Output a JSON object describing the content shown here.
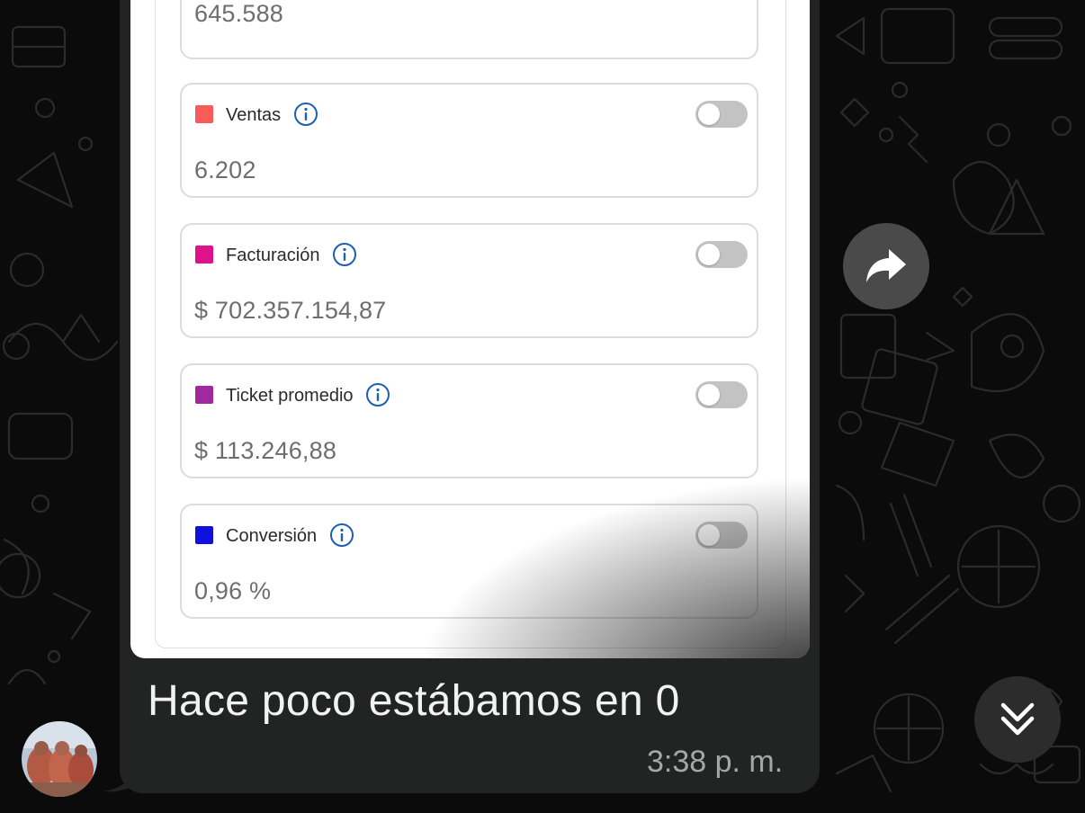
{
  "metrics": [
    {
      "label": "",
      "value": "645.588",
      "color": "#ffffff",
      "toggle_on": false
    },
    {
      "label": "Ventas",
      "value": "6.202",
      "color": "#f95b5b",
      "toggle_on": false
    },
    {
      "label": "Facturación",
      "value": "$ 702.357.154,87",
      "color": "#e0128a",
      "toggle_on": false
    },
    {
      "label": "Ticket promedio",
      "value": "$ 113.246,88",
      "color": "#a0299f",
      "toggle_on": false
    },
    {
      "label": "Conversión",
      "value": "0,96 %",
      "color": "#1111dd",
      "toggle_on": false
    }
  ],
  "message": {
    "text": "Hace poco estábamos en 0",
    "time": "3:38 p. m."
  },
  "icons": {
    "forward": "forward-arrow-icon",
    "scroll_down": "double-chevron-down-icon",
    "info": "info-icon",
    "avatar": "avatar"
  },
  "colors": {
    "bubble": "#222424",
    "background": "#0b0b0b",
    "info_blue": "#1d5fb3"
  }
}
